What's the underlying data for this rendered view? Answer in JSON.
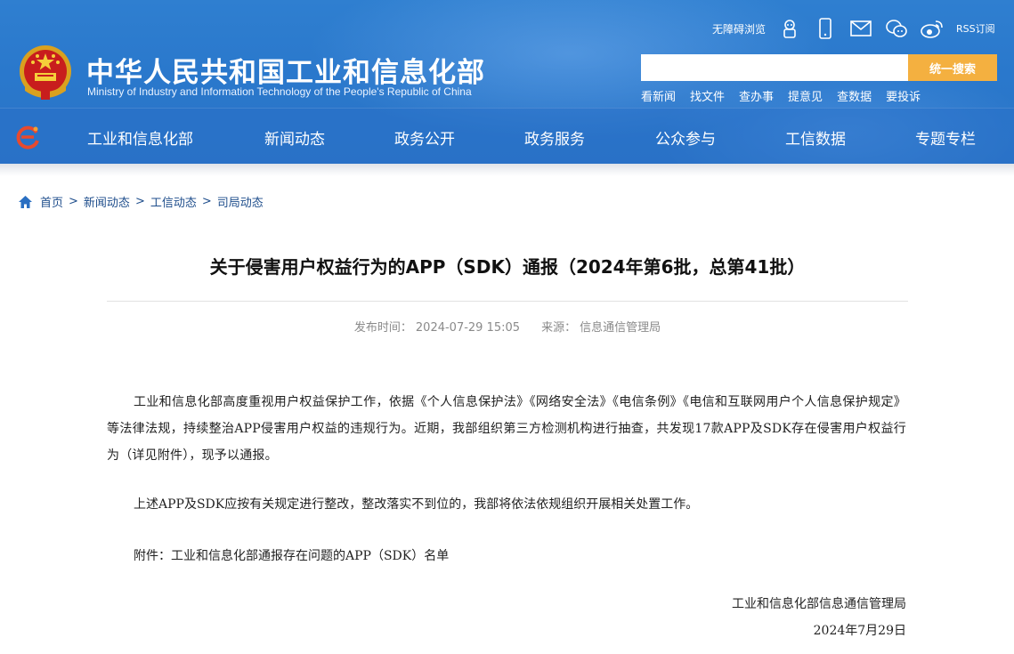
{
  "header": {
    "site_title": "中华人民共和国工业和信息化部",
    "site_subtitle": "Ministry of Industry and Information Technology of the People's Republic of China",
    "accessible_label": "无障碍浏览",
    "rss_label": "RSS订阅",
    "search": {
      "placeholder": "",
      "button_label": "统一搜索"
    },
    "quick_links": [
      "看新闻",
      "找文件",
      "查办事",
      "提意见",
      "查数据",
      "要投诉"
    ],
    "nav": [
      "工业和信息化部",
      "新闻动态",
      "政务公开",
      "政务服务",
      "公众参与",
      "工信数据",
      "专题专栏"
    ],
    "colors": {
      "header_blue": "#2a78cc",
      "search_button": "#f4b040"
    },
    "icons": [
      "emblem-icon",
      "robot-icon",
      "mobile-icon",
      "mail-icon",
      "wechat-icon",
      "weibo-icon",
      "nav-logo-icon"
    ]
  },
  "breadcrumb": [
    "首页",
    "新闻动态",
    "工信动态",
    "司局动态"
  ],
  "article": {
    "title": "关于侵害用户权益行为的APP（SDK）通报（2024年第6批，总第41批）",
    "publish_label": "发布时间：",
    "publish_time": "2024-07-29 15:05",
    "source_label": "来源：",
    "source": "信息通信管理局",
    "paragraphs": [
      "工业和信息化部高度重视用户权益保护工作，依据《个人信息保护法》《网络安全法》《电信条例》《电信和互联网用户个人信息保护规定》等法律法规，持续整治APP侵害用户权益的违规行为。近期，我部组织第三方检测机构进行抽查，共发现17款APP及SDK存在侵害用户权益行为（详见附件），现予以通报。",
      "上述APP及SDK应按有关规定进行整改，整改落实不到位的，我部将依法依规组织开展相关处置工作。",
      "附件：工业和信息化部通报存在问题的APP（SDK）名单"
    ],
    "signature_org": "工业和信息化部信息通信管理局",
    "signature_date": "2024年7月29日"
  }
}
